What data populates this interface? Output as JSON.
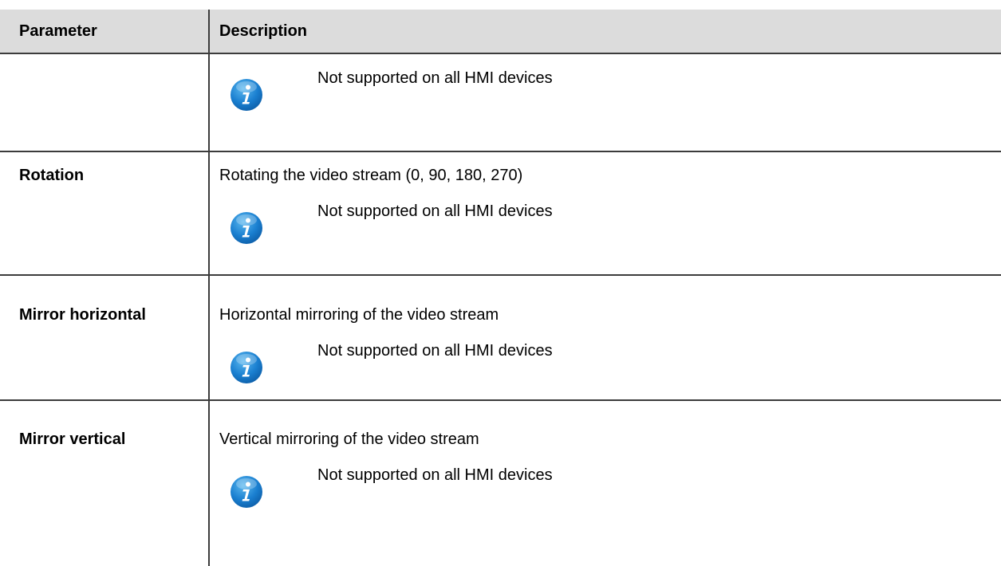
{
  "table": {
    "headers": {
      "parameter": "Parameter",
      "description": "Description"
    },
    "rows": [
      {
        "parameter": "",
        "description": "",
        "note": "Not supported on all HMI devices"
      },
      {
        "parameter": "Rotation",
        "description": "Rotating the video stream (0, 90, 180, 270)",
        "note": "Not supported on all HMI devices"
      },
      {
        "parameter": "Mirror horizontal",
        "description": "Horizontal mirroring of the video stream",
        "note": "Not supported on all HMI devices"
      },
      {
        "parameter": "Mirror vertical",
        "description": "Vertical mirroring of the video stream",
        "note": "Not supported on all HMI devices"
      }
    ]
  },
  "icons": {
    "note_icon": "info-icon"
  },
  "colors": {
    "header_background": "#dcdcdc",
    "rule_color": "#3c3c3c",
    "icon_blue": "#1a7fd0"
  }
}
